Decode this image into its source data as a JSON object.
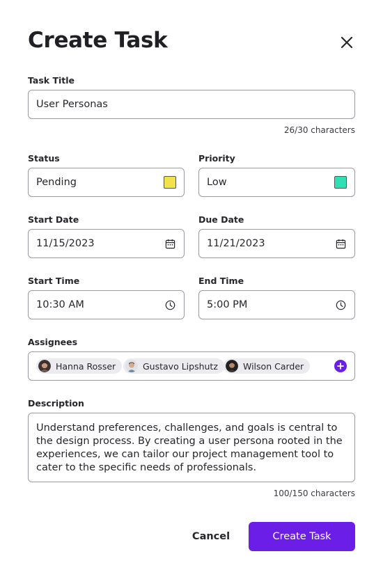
{
  "dialog": {
    "title": "Create Task"
  },
  "task_title": {
    "label": "Task Title",
    "value": "User Personas",
    "counter": "26/30 characters"
  },
  "status": {
    "label": "Status",
    "value": "Pending",
    "color": "#f2e24a"
  },
  "priority": {
    "label": "Priority",
    "value": "Low",
    "color": "#2ee0b4"
  },
  "start_date": {
    "label": "Start Date",
    "value": "11/15/2023",
    "icon": "calendar-icon"
  },
  "due_date": {
    "label": "Due Date",
    "value": "11/21/2023",
    "icon": "calendar-icon"
  },
  "start_time": {
    "label": "Start Time",
    "value": "10:30 AM",
    "icon": "clock-icon"
  },
  "end_time": {
    "label": "End Time",
    "value": "5:00 PM",
    "icon": "clock-icon"
  },
  "assignees": {
    "label": "Assignees",
    "people": [
      {
        "name": "Hanna Rosser"
      },
      {
        "name": "Gustavo Lipshutz"
      },
      {
        "name": "Wilson Carder"
      }
    ],
    "add_icon": "plus-icon"
  },
  "description": {
    "label": "Description",
    "value": "Understand preferences, challenges, and goals is central to the design process. By creating a user persona rooted in the experiences, we can tailor our project management tool to cater to the specific needs of professionals.",
    "counter": "100/150 characters"
  },
  "actions": {
    "cancel": "Cancel",
    "submit": "Create Task"
  },
  "colors": {
    "accent": "#6b1fe6"
  }
}
